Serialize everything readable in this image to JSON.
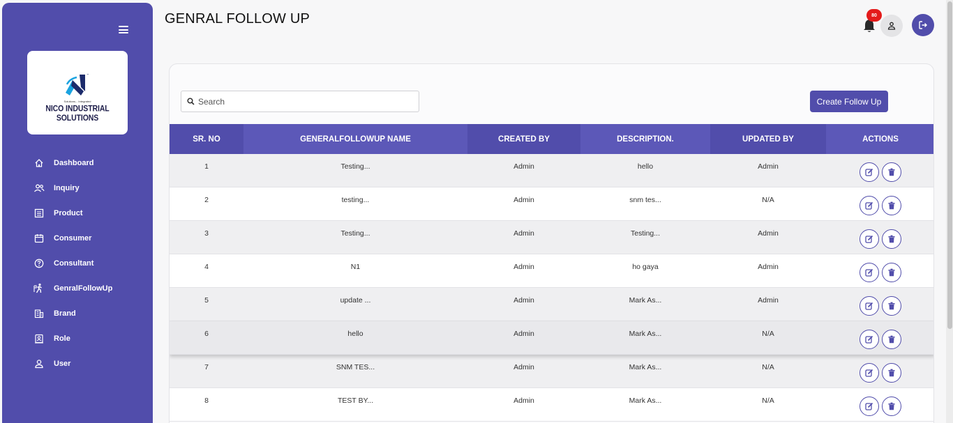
{
  "sidebar": {
    "logo": {
      "name": "NICO INDUSTRIAL SOLUTIONS",
      "tagline": "Solutions... Integrated",
      "trademark": "™"
    },
    "items": [
      {
        "label": "Dashboard",
        "icon": "home-icon"
      },
      {
        "label": "Inquiry",
        "icon": "users-icon"
      },
      {
        "label": "Product",
        "icon": "list-icon"
      },
      {
        "label": "Consumer",
        "icon": "calendar-icon"
      },
      {
        "label": "Consultant",
        "icon": "help-circle-icon"
      },
      {
        "label": "GenralFollowUp",
        "icon": "walking-person-icon"
      },
      {
        "label": "Brand",
        "icon": "building-icon"
      },
      {
        "label": "Role",
        "icon": "id-card-icon"
      },
      {
        "label": "User",
        "icon": "user-icon"
      }
    ]
  },
  "header": {
    "title": "GENRAL FOLLOW UP",
    "notification_count": "80"
  },
  "toolbar": {
    "search_placeholder": "Search",
    "search_value": "",
    "create_label": "Create Follow Up"
  },
  "table": {
    "columns": [
      "SR. NO",
      "GENERALFOLLOWUP NAME",
      "CREATED BY",
      "DESCRIPTION.",
      "UPDATED BY",
      "ACTIONS"
    ],
    "rows": [
      {
        "sr": "1",
        "name": "Testing...",
        "created_by": "Admin",
        "description": "hello",
        "updated_by": "Admin"
      },
      {
        "sr": "2",
        "name": "testing...",
        "created_by": "Admin",
        "description": "snm tes...",
        "updated_by": "N/A"
      },
      {
        "sr": "3",
        "name": "Testing...",
        "created_by": "Admin",
        "description": "Testing...",
        "updated_by": "Admin"
      },
      {
        "sr": "4",
        "name": "N1",
        "created_by": "Admin",
        "description": "ho gaya",
        "updated_by": "Admin"
      },
      {
        "sr": "5",
        "name": "update ...",
        "created_by": "Admin",
        "description": "Mark As...",
        "updated_by": "Admin"
      },
      {
        "sr": "6",
        "name": "hello",
        "created_by": "Admin",
        "description": "Mark As...",
        "updated_by": "N/A"
      },
      {
        "sr": "7",
        "name": "SNM TES...",
        "created_by": "Admin",
        "description": "Mark As...",
        "updated_by": "N/A"
      },
      {
        "sr": "8",
        "name": "TEST BY...",
        "created_by": "Admin",
        "description": "Mark As...",
        "updated_by": "N/A"
      }
    ]
  },
  "colors": {
    "primary": "#514dab",
    "header_alt": "#5c58b8",
    "badge": "#e41b1b"
  }
}
